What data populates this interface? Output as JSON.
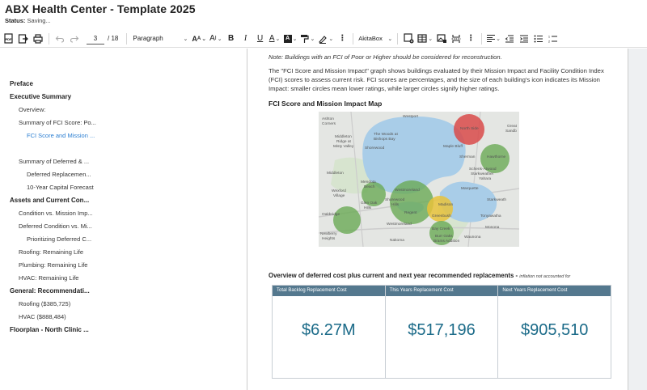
{
  "header": {
    "title": "ABX Health Center - Template 2025",
    "status_label": "Status:",
    "status_value": "Saving..."
  },
  "toolbar": {
    "page_current": "3",
    "page_separator": "/",
    "page_total": "18",
    "paragraph_style": "Paragraph",
    "font_family": "AkitaBox",
    "icons": [
      "export-pdf-icon",
      "import-icon",
      "print-icon",
      "undo-icon",
      "redo-icon",
      "text-size-icon",
      "font-size-icon",
      "bold-icon",
      "italic-icon",
      "underline-icon",
      "font-color-icon",
      "highlight-color-icon",
      "paint-format-icon",
      "eraser-icon",
      "more-icon",
      "insert-image-icon",
      "insert-table-icon",
      "insert-gallery-icon",
      "page-break-icon",
      "more-icon",
      "align-left-icon",
      "outdent-icon",
      "indent-icon",
      "bulleted-list-icon",
      "numbered-list-icon"
    ]
  },
  "outline": [
    {
      "label": "Preface",
      "level": 0
    },
    {
      "label": "Executive Summary",
      "level": 0
    },
    {
      "label": "Overview:",
      "level": 1
    },
    {
      "label": "Summary of FCI Score: Po...",
      "level": 1
    },
    {
      "label": "FCI Score and Mission ...",
      "level": 2,
      "active": true
    },
    {
      "label": "",
      "level": 2
    },
    {
      "label": "Summary of Deferred & ...",
      "level": 1
    },
    {
      "label": "Deferred Replacemen...",
      "level": 2
    },
    {
      "label": "10-Year Capital Forecast",
      "level": 2
    },
    {
      "label": "Assets and Current Con...",
      "level": 0
    },
    {
      "label": "Condition vs. Mission Imp...",
      "level": 1
    },
    {
      "label": "Deferred Condition vs. Mi...",
      "level": 1
    },
    {
      "label": "Prioritizing Deferred C...",
      "level": 2
    },
    {
      "label": "Roofing: Remaining Life",
      "level": 1
    },
    {
      "label": "Plumbing: Remaining Life",
      "level": 1
    },
    {
      "label": "HVAC: Remaining Life",
      "level": 1
    },
    {
      "label": "General: Recommendati...",
      "level": 0
    },
    {
      "label": "Roofing ($385,725)",
      "level": 1
    },
    {
      "label": "HVAC ($888,484)",
      "level": 1
    },
    {
      "label": "Floorplan - North Clinic ...",
      "level": 0
    }
  ],
  "document": {
    "note": "Note: Buildings with an FCI of Poor or Higher should be considered for reconstruction.",
    "description": "The \"FCI Score and Mission Impact\" graph shows buildings evaluated by their Mission Impact and Facility Condition Index (FCI) scores to assess current risk. FCI scores are percentages, and the size of each building's icon indicates its Mission Impact: smaller circles mean lower ratings, while larger circles signify higher ratings.",
    "map_heading": "FCI Score and Mission Impact Map",
    "map": {
      "place_labels": [
        "Westport",
        "Ashton Corners",
        "Middleton Ridge at Misty Valley",
        "The Woods at Bishops Bay",
        "Shorewood",
        "Maple Bluff",
        "North Side",
        "Great Sandb",
        "Sherman",
        "Hawthorne",
        "Schenk-Atwood Starkweather Yahara",
        "Middleton",
        "Mendota Beach",
        "Westmoreland",
        "Marquette",
        "Glen Oak Hills",
        "Shorewood Hills",
        "Regent",
        "Madison",
        "Starkweath",
        "Wexford Village",
        "Oakbridge",
        "Tonyawatha",
        "Bay Creek",
        "Burr Oaks",
        "Greenbush",
        "Monona",
        "Newberry Heights",
        "Nakoma",
        "Brams Addition",
        "Waunona"
      ],
      "colors": {
        "water": "#a9cde8",
        "land": "#e4e6e3",
        "park": "#cfe0c4",
        "poor": "#d94a4a",
        "fair": "#e8c23b",
        "good": "#6aaa55",
        "road": "#c9c9c9"
      }
    },
    "overview_heading": "Overview of deferred cost plus current and next year recommended replacements",
    "overview_separator": " - ",
    "overview_note": "inflation not accounted for",
    "costs": [
      {
        "header": "Total Backlog Replacement Cost",
        "value": "$6.27M"
      },
      {
        "header": "This Years Replacement Cost",
        "value": "$517,196"
      },
      {
        "header": "Next Years Replacement Cost",
        "value": "$905,510"
      }
    ],
    "header_color": "#54788e",
    "value_color": "#1a6a88"
  }
}
